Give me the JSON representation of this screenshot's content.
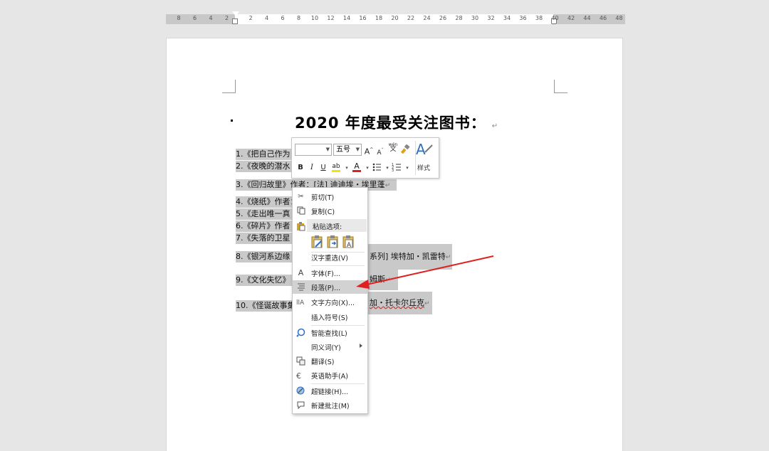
{
  "ruler": {
    "numbers": [
      "8",
      "6",
      "4",
      "2",
      "2",
      "4",
      "6",
      "8",
      "10",
      "12",
      "14",
      "16",
      "18",
      "20",
      "22",
      "24",
      "26",
      "28",
      "30",
      "32",
      "34",
      "36",
      "38",
      "40",
      "42",
      "44",
      "46",
      "48"
    ]
  },
  "document": {
    "title": "2020 年度最受关注图书：",
    "lines": [
      {
        "text": "1.《把自己作为"
      },
      {
        "text": "2.《夜晚的潜水"
      },
      {
        "text": "3.《回归故里》作者：[法] 迪迪埃・埃里蓬"
      },
      {
        "text": "4.《烧纸》作者："
      },
      {
        "text": "5.《走出唯一真"
      },
      {
        "text": "6.《碎片》作者"
      },
      {
        "text": "7.《失落的卫星"
      },
      {
        "text_prefix": "8.《银河系边缘",
        "text_suffix": "系列] 埃特加・凯雷特"
      },
      {
        "text_prefix": "9.《文化失忆》",
        "text_suffix": "姆斯"
      },
      {
        "text_prefix": "10.《怪诞故事集",
        "text_suffix": "加・托卡尔丘克"
      }
    ],
    "paragraph_mark": "↵"
  },
  "mini_toolbar": {
    "font_name": "",
    "font_size": "五号",
    "grow_font": "A",
    "shrink_font": "A",
    "phonetic": "wén",
    "phonetic_char": "文",
    "bold": "B",
    "italic": "I",
    "underline": "U",
    "highlight": "ab",
    "font_color": "A",
    "styles_label": "样式"
  },
  "context_menu": {
    "items": [
      {
        "label": "剪切(T)",
        "icon": "scissors-icon"
      },
      {
        "label": "复制(C)",
        "icon": "copy-icon"
      },
      {
        "label": "粘贴选项:",
        "icon": "paste-icon"
      },
      {
        "label": "汉字重选(V)",
        "icon": ""
      },
      {
        "label": "字体(F)...",
        "icon": "font-icon"
      },
      {
        "label": "段落(P)...",
        "icon": "paragraph-icon"
      },
      {
        "label": "文字方向(X)...",
        "icon": "text-direction-icon"
      },
      {
        "label": "插入符号(S)",
        "icon": ""
      },
      {
        "label": "智能查找(L)",
        "icon": "smart-lookup-icon"
      },
      {
        "label": "同义词(Y)",
        "icon": ""
      },
      {
        "label": "翻译(S)",
        "icon": "translate-icon"
      },
      {
        "label": "英语助手(A)",
        "icon": "english-assistant-icon"
      },
      {
        "label": "超链接(H)...",
        "icon": "hyperlink-icon"
      },
      {
        "label": "新建批注(M)",
        "icon": "new-comment-icon"
      }
    ],
    "highlighted": "段落(P)..."
  },
  "colors": {
    "arrow": "#e02020",
    "selection": "#c9c9c9",
    "highlight_bar": "#f2e600",
    "font_color_bar": "#e02020"
  }
}
